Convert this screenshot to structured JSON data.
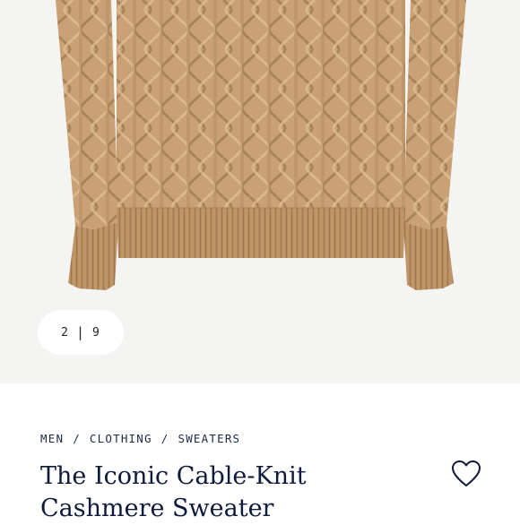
{
  "gallery": {
    "image_alt": "camel cable-knit cashmere sweater",
    "current": "2",
    "separator": "|",
    "total": "9"
  },
  "breadcrumb": {
    "items": [
      "MEN",
      "CLOTHING",
      "SWEATERS"
    ],
    "separator": "/"
  },
  "product": {
    "title_line1": "The Iconic Cable-Knit",
    "title_line2": "Cashmere Sweater"
  },
  "icons": {
    "wishlist": "heart-icon"
  },
  "colors": {
    "sweater": "#c9a174",
    "text_navy": "#0e1a3a",
    "gallery_bg": "#f4f4f2"
  }
}
